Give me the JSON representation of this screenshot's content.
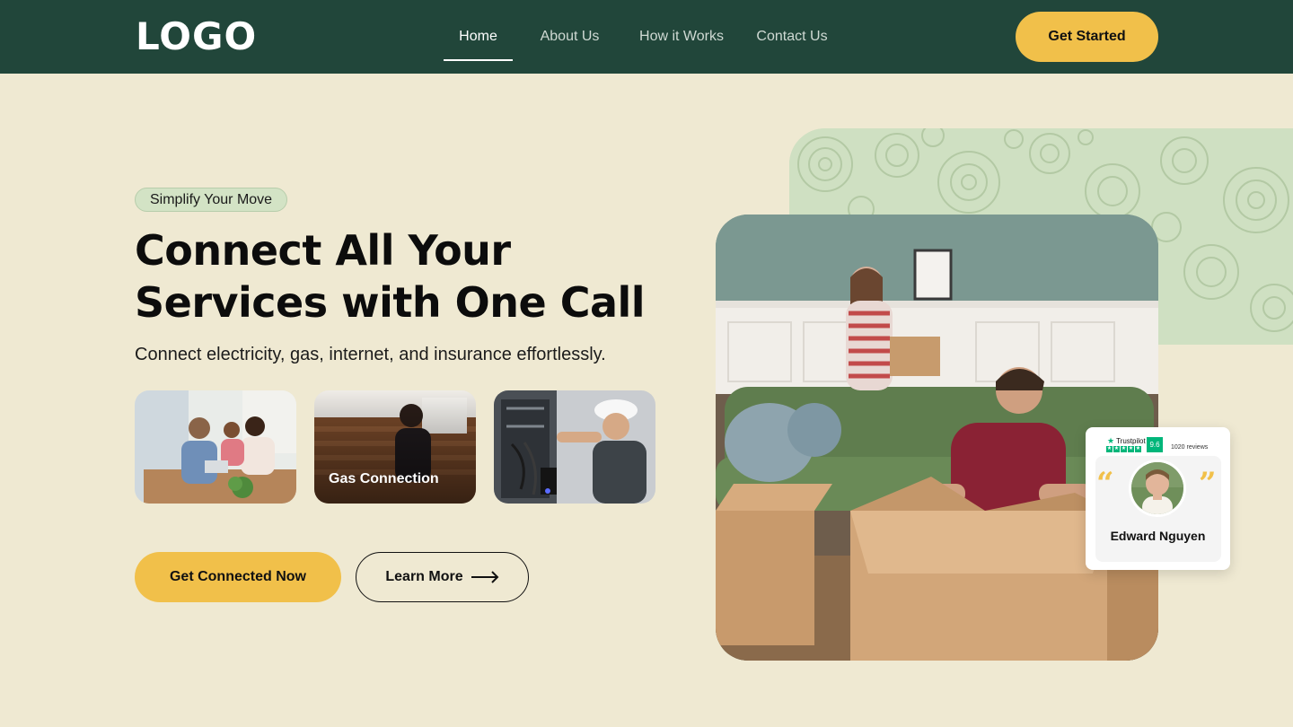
{
  "header": {
    "logo": "LOGO",
    "nav": [
      {
        "label": "Home",
        "active": true
      },
      {
        "label": "About Us",
        "active": false
      },
      {
        "label": "How it Works",
        "active": false
      },
      {
        "label": "Contact Us",
        "active": false
      }
    ],
    "cta": "Get Started"
  },
  "hero": {
    "pill": "Simplify Your Move",
    "headline_line1": "Connect All Your",
    "headline_line2": "Services with One Call",
    "subheading": "Connect electricity, gas, internet, and insurance effortlessly.",
    "cards": [
      {
        "caption": "",
        "image": "family-meeting-photo"
      },
      {
        "caption": "Gas Connection",
        "image": "gas-connection-photo"
      },
      {
        "caption": "",
        "image": "electrician-photo"
      }
    ],
    "primary_button": "Get Connected Now",
    "secondary_button": "Learn More"
  },
  "review": {
    "platform": "Trustpilot",
    "score": "9.6",
    "review_count": "1020 reviews",
    "reviewer": "Edward Nguyen"
  },
  "colors": {
    "header_bg": "#21463a",
    "page_bg": "#efe9d2",
    "accent_yellow": "#f1c04a",
    "pill_green": "#d3e3c5",
    "trustpilot_green": "#00b67a"
  }
}
